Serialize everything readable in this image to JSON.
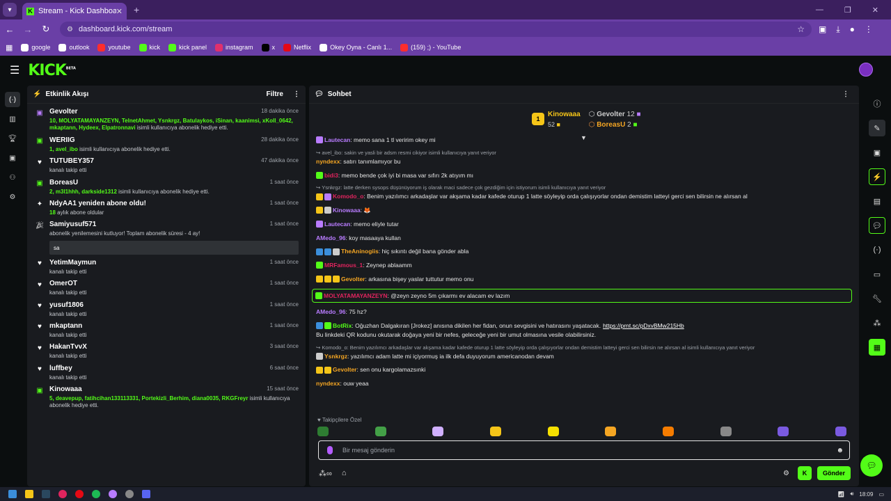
{
  "browser": {
    "tab_title": "Stream - Kick Dashboard",
    "url": "dashboard.kick.com/stream",
    "bookmarks": [
      {
        "label": "google",
        "color": "#ffffff"
      },
      {
        "label": "outlook",
        "color": "#ffffff"
      },
      {
        "label": "youtube",
        "color": "#ff2d2d"
      },
      {
        "label": "kick",
        "color": "#53fc18"
      },
      {
        "label": "kick panel",
        "color": "#53fc18"
      },
      {
        "label": "instagram",
        "color": "#e1306c"
      },
      {
        "label": "x",
        "color": "#000000"
      },
      {
        "label": "Netflix",
        "color": "#e50914"
      },
      {
        "label": "Okey Oyna - Canlı 1...",
        "color": "#ffffff"
      },
      {
        "label": "(159) ;) - YouTube",
        "color": "#ff2d2d"
      }
    ]
  },
  "activity": {
    "title": "Etkinlik Akışı",
    "filter_label": "Filtre",
    "events": [
      {
        "icon": "gift-icon",
        "icon_color": "#b97cff",
        "name": "Gevolter",
        "time": "18 dakika önce",
        "highlight": "10, MOLYATAMAYANZEYN, TelnetAhmet, Ysnkrgz, Batulaykos, iSinan, kaanimsi, xKoll_0642, mkaptann, Hydeex, Elpatronnavi",
        "text": " isimli kullanıcıya abonelik hediye etti."
      },
      {
        "icon": "gift-icon",
        "icon_color": "#53fc18",
        "name": "WERIIG",
        "time": "28 dakika önce",
        "highlight": "1, avel_ibo",
        "text": " isimli kullanıcıya abonelik hediye etti."
      },
      {
        "icon": "heart-icon",
        "icon_color": "#ffffff",
        "name": "TUTUBEY357",
        "time": "47 dakika önce",
        "highlight": "",
        "text": "kanalı takip etti"
      },
      {
        "icon": "gift-icon",
        "icon_color": "#53fc18",
        "name": "BoreasU",
        "time": "1 saat önce",
        "highlight": "2, m3l1hhh, darkside1312",
        "text": " isimli kullanıcıya abonelik hediye etti."
      },
      {
        "icon": "sparkle-icon",
        "icon_color": "#ffffff",
        "name": "NdyAA1 yeniden abone oldu!",
        "time": "1 saat önce",
        "highlight": "18",
        "text": " aylık abone oldular"
      },
      {
        "icon": "confetti-icon",
        "icon_color": "#ffffff",
        "name": "Samiyusuf571",
        "time": "1 saat önce",
        "highlight": "",
        "text": "abonelik yenilemesini kutluyor! Toplam abonelik süresi - 4 ay!",
        "message": "sa"
      },
      {
        "icon": "heart-icon",
        "icon_color": "#ffffff",
        "name": "YetimMaymun",
        "time": "1 saat önce",
        "highlight": "",
        "text": "kanalı takip etti"
      },
      {
        "icon": "heart-icon",
        "icon_color": "#ffffff",
        "name": "OmerOT",
        "time": "1 saat önce",
        "highlight": "",
        "text": "kanalı takip etti"
      },
      {
        "icon": "heart-icon",
        "icon_color": "#ffffff",
        "name": "yusuf1806",
        "time": "1 saat önce",
        "highlight": "",
        "text": "kanalı takip etti"
      },
      {
        "icon": "heart-icon",
        "icon_color": "#ffffff",
        "name": "mkaptann",
        "time": "1 saat önce",
        "highlight": "",
        "text": "kanalı takip etti"
      },
      {
        "icon": "heart-icon",
        "icon_color": "#ffffff",
        "name": "HakanTvvX",
        "time": "3 saat önce",
        "highlight": "",
        "text": "kanalı takip etti"
      },
      {
        "icon": "heart-icon",
        "icon_color": "#ffffff",
        "name": "luffbey",
        "time": "6 saat önce",
        "highlight": "",
        "text": "kanalı takip etti"
      },
      {
        "icon": "gift-icon",
        "icon_color": "#53fc18",
        "name": "Kinowaaa",
        "time": "15 saat önce",
        "highlight": "5, deavepup, fatihcihan133113331, Portekizli_Berhim, diana0035, RKGFreyr",
        "text": " isimli kullanıcıya abonelik hediye etti."
      }
    ]
  },
  "chat": {
    "title": "Sohbet",
    "leaderboard": {
      "first": {
        "name": "Kinowaaa",
        "count": "52",
        "rank": "1"
      },
      "second": {
        "name": "Gevolter",
        "count": "12"
      },
      "third": {
        "name": "BoreasU",
        "count": "2"
      }
    },
    "messages": [
      {
        "user": "Lautecan",
        "color": "#b97cff",
        "badges": [
          "#b97cff"
        ],
        "text": ": memo sana 1 tl veririm okey mi"
      },
      {
        "reply": "↪ avel_ibo: sakin ve yasli bir adsm resmi cikiyor isimli kullanıcıya yanıt veriyor",
        "user": "nyndexx",
        "color": "#f5a623",
        "badges": [],
        "text": ": satırı tanımlamıyor bu"
      },
      {
        "user": "bidi3",
        "color": "#e0245e",
        "badges": [
          "#53fc18"
        ],
        "text": ": memo bende çok iyi bi masa var sıfırı 2k atıyım mı"
      },
      {
        "reply": "↪ Ysnkrgz: latte derken sysops düşünüyorum iş olarak maci sadece çok gezdiğim için istiyorum isimli kullanıcıya yanıt veriyor",
        "user": "Komodo_o",
        "color": "#e0245e",
        "badges": [
          "#f5c518",
          "#b97cff"
        ],
        "text": ": Benim yazılımcı arkadaşlar var akşama kadar kafede oturup 1 latte söyleyip orda çalışıyorlar ondan demistim latteyi gerci sen bilirsin ne alırsan al"
      },
      {
        "user": "Kinowaaa",
        "color": "#b97cff",
        "badges": [
          "#f5c518",
          "#cccccc"
        ],
        "text": ":  🦊"
      },
      {
        "user": "Lautecan",
        "color": "#b97cff",
        "badges": [
          "#b97cff"
        ],
        "text": ": memo eliyle tutar"
      },
      {
        "user": "AMedo_96",
        "color": "#b97cff",
        "badges": [],
        "text": ": koy masaaya kullan"
      },
      {
        "user": "TheAninogiis",
        "color": "#f5a623",
        "badges": [
          "#3b8edb",
          "#3b8edb",
          "#cccccc"
        ],
        "text": ": hiç sıkıntı değil bana gönder abla"
      },
      {
        "user": "MRFamous_1",
        "color": "#e0245e",
        "badges": [
          "#53fc18"
        ],
        "text": ": Zeynep ablaamm"
      },
      {
        "user": "Gevolter",
        "color": "#f5a623",
        "badges": [
          "#f5c518",
          "#f5c518",
          "#f5c518"
        ],
        "text": ": arkasına bişey yaslar tuttutur memo onu"
      },
      {
        "user": "MOLYATAMAYANZEYN",
        "color": "#e0245e",
        "badges": [
          "#53fc18"
        ],
        "text": ": @zeyn zeyno 5m çıkarmı ev alacam ev lazım",
        "highlight": true
      },
      {
        "user": "AMedo_96",
        "color": "#b97cff",
        "badges": [],
        "text": ": 75 hz?"
      },
      {
        "user": "BotRix",
        "color": "#53fc18",
        "badges": [
          "#3b8edb",
          "#53fc18"
        ],
        "text": ": Oğuzhan Dalgakıran [Jrokez] anısına dikilen her fidan, onun sevgisini ve hatırasını yaşatacak.",
        "link": "https://prnt.sc/pDxvBMw215Hb",
        "text2": " Bu linkdeki QR kodunu okutarak doğaya yeni bir nefes, geleceğe yeni bir umut olmasına vesile olabilirsiniz."
      },
      {
        "reply": "↪ Komodo_o: Benim yazılımcı arkadaşlar var akşama kadar kafede oturup 1 latte söyleyip orda çalışıyorlar ondan demistim latteyi gerci sen bilirsin ne alırsan al isimli kullanıcıya yanıt veriyor",
        "user": "Ysnkrgz",
        "color": "#f5a623",
        "badges": [
          "#cccccc"
        ],
        "text": ": yazılımcı adam latte mi içiyormuş ia ilk defa duyuyorum americanodan devam"
      },
      {
        "user": "Gevolter",
        "color": "#f5a623",
        "badges": [
          "#f5c518",
          "#f5c518"
        ],
        "text": ": sen onu kargolamazsınki"
      },
      {
        "user": "nyndexx",
        "color": "#f5a623",
        "badges": [],
        "text": ": ouw yeaa"
      }
    ],
    "subs_label": "♥ Takipçilere Özel",
    "emote_colors": [
      "#2e7d32",
      "#43a047",
      "#d0b0ff",
      "#f5c518",
      "#f5e000",
      "#f5a623",
      "#f57c00",
      "#888888",
      "#7a5ae0",
      "#7a5ae0"
    ],
    "input_placeholder": "Bir mesaj gönderin",
    "send_label": "Gönder"
  },
  "taskbar": {
    "time": "18:09"
  }
}
